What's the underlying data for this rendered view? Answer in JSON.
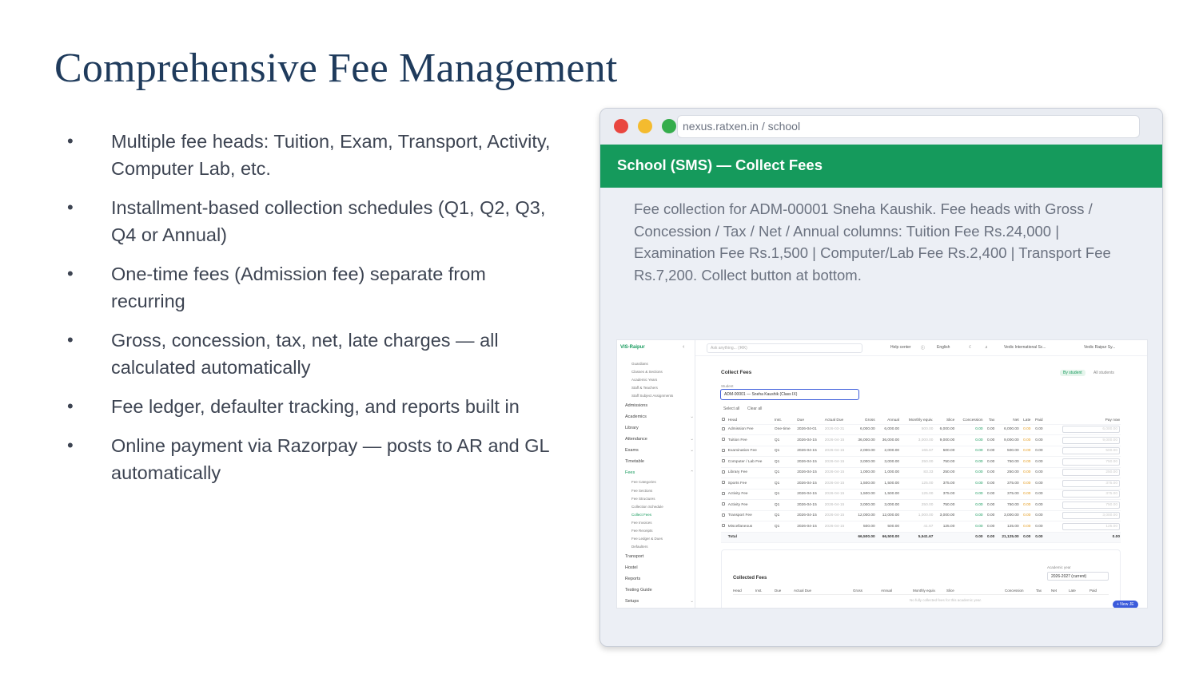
{
  "slide": {
    "title": "Comprehensive Fee Management",
    "bullet_marker": "•",
    "bullets": [
      "Multiple fee heads: Tuition, Exam, Transport, Activity, Computer Lab, etc.",
      "Installment-based collection schedules (Q1, Q2, Q3, Q4 or Annual)",
      "One-time fees (Admission fee) separate from recurring",
      "Gross, concession, tax, net, late charges — all calculated automatically",
      "Fee ledger, defaulter tracking, and reports built in",
      "Online payment via Razorpay — posts to AR and GL automatically"
    ]
  },
  "browser": {
    "url": "nexus.ratxen.in / school",
    "header": "School (SMS) — Collect Fees",
    "description": "Fee collection for ADM-00001 Sneha Kaushik. Fee heads with Gross / Concession / Tax / Net / Annual columns: Tuition Fee Rs.24,000 | Examination Fee Rs.1,500 | Computer/Lab Fee Rs.2,400 | Transport Fee Rs.7,200. Collect button at bottom."
  },
  "app": {
    "brand": "VIS-Raipur",
    "nav": [
      {
        "label": "Guardians",
        "level": "sub"
      },
      {
        "label": "Classes & Sections",
        "level": "sub"
      },
      {
        "label": "Academic Years",
        "level": "sub"
      },
      {
        "label": "Staff & Teachers",
        "level": "sub"
      },
      {
        "label": "Staff Subject Assignments",
        "level": "sub"
      },
      {
        "label": "Admissions",
        "level": "top"
      },
      {
        "label": "Academics",
        "level": "top",
        "chevron": "⌄"
      },
      {
        "label": "Library",
        "level": "top"
      },
      {
        "label": "Attendance",
        "level": "top",
        "chevron": "⌄"
      },
      {
        "label": "Exams",
        "level": "top",
        "chevron": "⌄"
      },
      {
        "label": "Timetable",
        "level": "top"
      },
      {
        "label": "Fees",
        "level": "top",
        "chevron": "⌃",
        "active": true
      },
      {
        "label": "Fee Categories",
        "level": "sub"
      },
      {
        "label": "Fee Sections",
        "level": "sub"
      },
      {
        "label": "Fee Structures",
        "level": "sub"
      },
      {
        "label": "Collection Schedule",
        "level": "sub"
      },
      {
        "label": "Collect Fees",
        "level": "sub",
        "active": true
      },
      {
        "label": "Fee Invoices",
        "level": "sub"
      },
      {
        "label": "Fee Receipts",
        "level": "sub"
      },
      {
        "label": "Fee Ledger & Dues",
        "level": "sub"
      },
      {
        "label": "Defaulters",
        "level": "sub"
      },
      {
        "label": "Transport",
        "level": "top"
      },
      {
        "label": "Hostel",
        "level": "top"
      },
      {
        "label": "Reports",
        "level": "top"
      },
      {
        "label": "Testing Guide",
        "level": "top"
      },
      {
        "label": "Setups",
        "level": "top",
        "chevron": "⌄"
      }
    ],
    "topbar": {
      "search_placeholder": "Ask anything... (⌘K)",
      "help": "Help center",
      "language": "English",
      "company": "Vedic International Sc...",
      "user": "Vedic Raipur Sy..."
    },
    "page_title": "Collect Fees",
    "toggle_by_student": "By student",
    "toggle_all_students": "All students",
    "student_label": "Student",
    "student_value": "ADM-00001 — Sneha Kaushik (Class IX)",
    "select_all": "Select all",
    "clear_all": "Clear all",
    "columns": [
      "Head",
      "Inst.",
      "Due",
      "Actual Due",
      "Gross",
      "Annual",
      "Monthly equiv.",
      "Slice",
      "Concession",
      "Tax",
      "Net",
      "Late",
      "Paid",
      "Pay now"
    ],
    "rows": [
      {
        "head": "Admission Fee",
        "inst": "One-time",
        "due": "2026-04-01",
        "actual_due": "2026-03-31",
        "gross": "6,000.00",
        "annual": "6,000.00",
        "monthly": "500.00",
        "slice": "6,000.00",
        "concession": "0.00",
        "tax": "0.00",
        "net": "6,000.00",
        "late": "0.00",
        "paid": "0.00",
        "pay_now": "6,000.00"
      },
      {
        "head": "Tuition Fee",
        "inst": "Q1",
        "due": "2026-04-15",
        "actual_due": "2026-04-15",
        "gross": "36,000.00",
        "annual": "36,000.00",
        "monthly": "3,000.00",
        "slice": "9,000.00",
        "concession": "0.00",
        "tax": "0.00",
        "net": "9,000.00",
        "late": "0.00",
        "paid": "0.00",
        "pay_now": "9,000.00"
      },
      {
        "head": "Examination Fee",
        "inst": "Q1",
        "due": "2026-04-15",
        "actual_due": "2026-04-15",
        "gross": "2,000.00",
        "annual": "2,000.00",
        "monthly": "166.67",
        "slice": "500.00",
        "concession": "0.00",
        "tax": "0.00",
        "net": "500.00",
        "late": "0.00",
        "paid": "0.00",
        "pay_now": "500.00"
      },
      {
        "head": "Computer / Lab Fee",
        "inst": "Q1",
        "due": "2026-04-15",
        "actual_due": "2026-04-15",
        "gross": "3,000.00",
        "annual": "3,000.00",
        "monthly": "250.00",
        "slice": "750.00",
        "concession": "0.00",
        "tax": "0.00",
        "net": "750.00",
        "late": "0.00",
        "paid": "0.00",
        "pay_now": "750.00"
      },
      {
        "head": "Library Fee",
        "inst": "Q1",
        "due": "2026-04-15",
        "actual_due": "2026-04-15",
        "gross": "1,000.00",
        "annual": "1,000.00",
        "monthly": "83.33",
        "slice": "250.00",
        "concession": "0.00",
        "tax": "0.00",
        "net": "250.00",
        "late": "0.00",
        "paid": "0.00",
        "pay_now": "250.00"
      },
      {
        "head": "Sports Fee",
        "inst": "Q1",
        "due": "2026-04-15",
        "actual_due": "2026-04-15",
        "gross": "1,500.00",
        "annual": "1,500.00",
        "monthly": "125.00",
        "slice": "375.00",
        "concession": "0.00",
        "tax": "0.00",
        "net": "375.00",
        "late": "0.00",
        "paid": "0.00",
        "pay_now": "375.00"
      },
      {
        "head": "Activity Fee",
        "inst": "Q1",
        "due": "2026-04-15",
        "actual_due": "2026-04-15",
        "gross": "1,500.00",
        "annual": "1,500.00",
        "monthly": "125.00",
        "slice": "375.00",
        "concession": "0.00",
        "tax": "0.00",
        "net": "375.00",
        "late": "0.00",
        "paid": "0.00",
        "pay_now": "375.00"
      },
      {
        "head": "Activity Fee",
        "inst": "Q1",
        "due": "2026-04-15",
        "actual_due": "2026-04-15",
        "gross": "3,000.00",
        "annual": "3,000.00",
        "monthly": "250.00",
        "slice": "750.00",
        "concession": "0.00",
        "tax": "0.00",
        "net": "750.00",
        "late": "0.00",
        "paid": "0.00",
        "pay_now": "750.00"
      },
      {
        "head": "Transport Fee",
        "inst": "Q1",
        "due": "2026-04-15",
        "actual_due": "2026-04-15",
        "gross": "12,000.00",
        "annual": "12,000.00",
        "monthly": "1,000.00",
        "slice": "3,000.00",
        "concession": "0.00",
        "tax": "0.00",
        "net": "3,000.00",
        "late": "0.00",
        "paid": "0.00",
        "pay_now": "3,000.00"
      },
      {
        "head": "Miscellaneous",
        "inst": "Q1",
        "due": "2026-04-15",
        "actual_due": "2026-04-15",
        "gross": "500.00",
        "annual": "500.00",
        "monthly": "41.67",
        "slice": "125.00",
        "concession": "0.00",
        "tax": "0.00",
        "net": "125.00",
        "late": "0.00",
        "paid": "0.00",
        "pay_now": "125.00"
      }
    ],
    "total": {
      "label": "Total",
      "gross": "66,500.00",
      "annual": "66,500.00",
      "monthly": "5,541.67",
      "concession": "0.00",
      "tax": "0.00",
      "net": "21,125.00",
      "late": "0.00",
      "paid": "0.00",
      "pay_now": "0.00"
    },
    "academic_year_label": "Academic year",
    "academic_year_value": "2026-2027 (current)",
    "collected_title": "Collected Fees",
    "collected_columns": [
      "Head",
      "Inst.",
      "Due",
      "Actual Due",
      "Gross",
      "Annual",
      "Monthly equiv.",
      "Slice",
      "Concession",
      "Tax",
      "Net",
      "Late",
      "Paid"
    ],
    "collected_empty": "No fully collected fees for this academic year.",
    "new_je": "+ New JE"
  }
}
